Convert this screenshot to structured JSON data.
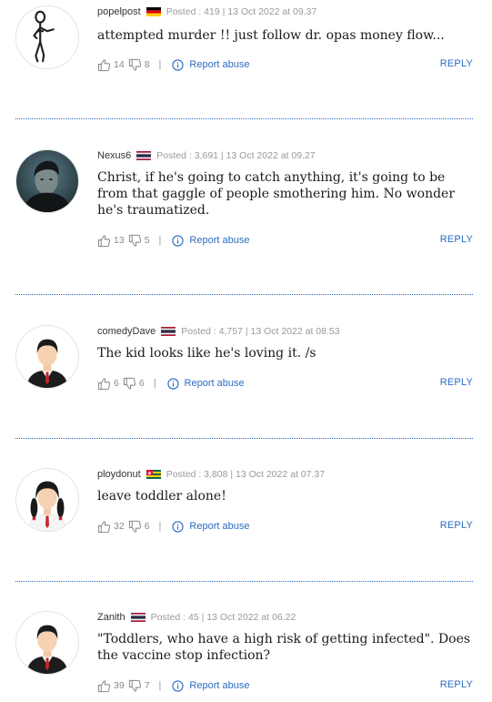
{
  "comments": [
    {
      "username": "popelpost",
      "flag": "germany",
      "posted": "Posted : 419 | 13 Oct 2022 at 09.37",
      "text": "attempted murder !! just follow dr. opas money flow...",
      "likes": "14",
      "dislikes": "8",
      "report_label": "Report abuse",
      "reply_label": "REPLY",
      "avatar": "stick-figure-avatar"
    },
    {
      "username": "Nexus6",
      "flag": "thailand",
      "posted": "Posted : 3,691 | 13 Oct 2022 at 09.27",
      "text": "Christ, if he's going to catch anything, it's going to be from that gaggle of people smothering him. No wonder he's traumatized.",
      "likes": "13",
      "dislikes": "5",
      "report_label": "Report abuse",
      "reply_label": "REPLY",
      "avatar": "photo-avatar"
    },
    {
      "username": "comedyDave",
      "flag": "thailand",
      "posted": "Posted : 4,757 | 13 Oct 2022 at 08.53",
      "text": "The kid looks like he's loving it. /s",
      "likes": "6",
      "dislikes": "6",
      "report_label": "Report abuse",
      "reply_label": "REPLY",
      "avatar": "default-male-avatar"
    },
    {
      "username": "ploydonut",
      "flag": "togo",
      "posted": "Posted : 3,808 | 13 Oct 2022 at 07.37",
      "text": "leave toddler alone!",
      "likes": "32",
      "dislikes": "6",
      "report_label": "Report abuse",
      "reply_label": "REPLY",
      "avatar": "default-female-avatar"
    },
    {
      "username": "Zanith",
      "flag": "thailand",
      "posted": "Posted : 45 | 13 Oct 2022 at 06.22",
      "text": "\"Toddlers, who have a high risk of getting infected\". Does the vaccine stop infection?",
      "likes": "39",
      "dislikes": "7",
      "report_label": "Report abuse",
      "reply_label": "REPLY",
      "avatar": "default-male-avatar"
    }
  ],
  "colors": {
    "link": "#2b6dc4",
    "divider": "#2b6dc4",
    "meta_gray": "#9a9a9a"
  },
  "icons": {
    "like": "thumbs-up-icon",
    "dislike": "thumbs-down-icon",
    "report": "info-circle-icon"
  }
}
